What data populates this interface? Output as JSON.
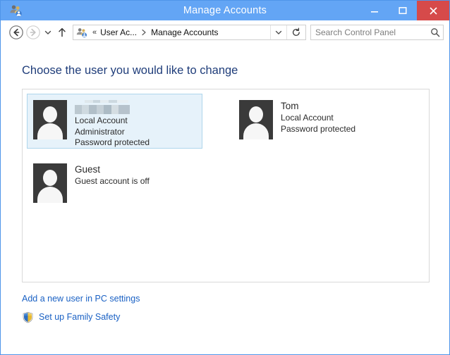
{
  "window": {
    "title": "Manage Accounts",
    "app_icon": "user-accounts-icon",
    "controls": {
      "minimize": "Minimize",
      "maximize": "Maximize",
      "close": "Close",
      "close_color": "#d64a4a"
    },
    "frame_color": "#63a5f5"
  },
  "navigation": {
    "back": "Back",
    "forward": "Forward",
    "recent_pages": "Recent pages",
    "up": "Up one level",
    "breadcrumb": {
      "icon": "user-accounts-icon",
      "overflow": "«",
      "items": [
        "User Ac...",
        "Manage Accounts"
      ],
      "separator": "▸"
    },
    "address_dropdown": "Previous locations",
    "refresh": "Refresh"
  },
  "search": {
    "placeholder": "Search Control Panel",
    "value": "",
    "icon": "search-icon"
  },
  "main": {
    "heading": "Choose the user you would like to change",
    "accounts": [
      {
        "name": "",
        "name_redacted": true,
        "lines": [
          "Local Account",
          "Administrator",
          "Password protected"
        ],
        "selected": true
      },
      {
        "name": "Tom",
        "name_redacted": false,
        "lines": [
          "Local Account",
          "Password protected"
        ],
        "selected": false
      },
      {
        "name": "Guest",
        "name_redacted": false,
        "lines": [
          "Guest account is off"
        ],
        "selected": false
      }
    ]
  },
  "links": [
    {
      "label": "Add a new user in PC settings",
      "icon": null
    },
    {
      "label": "Set up Family Safety",
      "icon": "uac-shield-icon"
    }
  ],
  "colors": {
    "title_bar": "#63a5f5",
    "heading": "#1f3d7a",
    "link": "#1a61c4",
    "selection_bg": "#e6f2fa",
    "selection_border": "#aed6ec",
    "avatar_bg": "#3a3a3a"
  }
}
